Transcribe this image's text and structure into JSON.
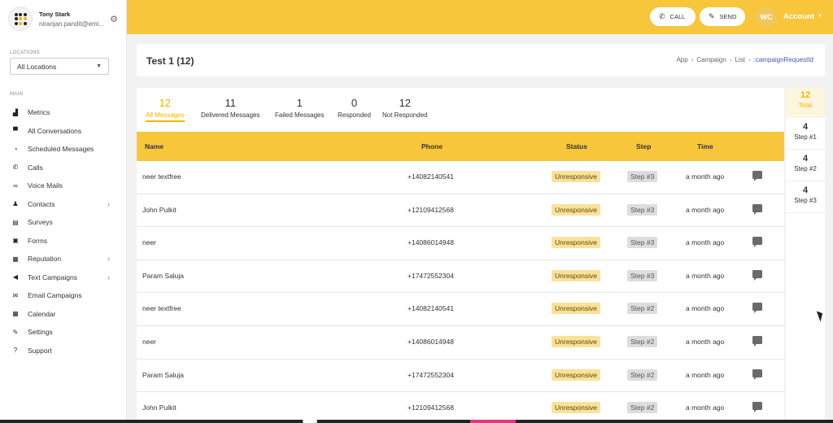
{
  "profile": {
    "name": "Tony Stark",
    "email": "niranjan.pandit@emi..."
  },
  "location": {
    "label": "LOCATIONS",
    "value": "All Locations"
  },
  "nav": {
    "section": "MAIN",
    "items": [
      {
        "label": "Metrics",
        "icon": "▟",
        "name": "metrics",
        "chevron": false
      },
      {
        "label": "All Conversations",
        "icon": "▀",
        "name": "all-conversations",
        "chevron": false
      },
      {
        "label": "Scheduled Messages",
        "icon": "◔",
        "name": "scheduled-messages",
        "chevron": false
      },
      {
        "label": "Calls",
        "icon": "✆",
        "name": "calls",
        "chevron": false
      },
      {
        "label": "Voice Mails",
        "icon": "∞",
        "name": "voice-mails",
        "chevron": false
      },
      {
        "label": "Contacts",
        "icon": "♟",
        "name": "contacts",
        "chevron": true
      },
      {
        "label": "Surveys",
        "icon": "▤",
        "name": "surveys",
        "chevron": false
      },
      {
        "label": "Forms",
        "icon": "▣",
        "name": "forms",
        "chevron": false
      },
      {
        "label": "Reputation",
        "icon": "▦",
        "name": "reputation",
        "chevron": true
      },
      {
        "label": "Text Campaigns",
        "icon": "◀",
        "name": "text-campaigns",
        "chevron": true
      },
      {
        "label": "Email Campaigns",
        "icon": "✉",
        "name": "email-campaigns",
        "chevron": false
      },
      {
        "label": "Calendar",
        "icon": "▦",
        "name": "calendar",
        "chevron": false
      },
      {
        "label": "Settings",
        "icon": "✎",
        "name": "settings",
        "chevron": false
      },
      {
        "label": "Support",
        "icon": "?",
        "name": "support",
        "chevron": false
      }
    ]
  },
  "topbar": {
    "call_label": "CALL",
    "send_label": "SEND",
    "avatar_initials": "WC",
    "account_label": "Account"
  },
  "header": {
    "title": "Test 1 (12)",
    "breadcrumb": [
      "App",
      "Campaign",
      "List",
      ":campaignRequestId"
    ]
  },
  "stats": [
    {
      "value": "12",
      "label": "All Messages",
      "active": true
    },
    {
      "value": "11",
      "label": "Delivered Messages",
      "active": false
    },
    {
      "value": "1",
      "label": "Failed Messages",
      "active": false
    },
    {
      "value": "0",
      "label": "Responded",
      "active": false
    },
    {
      "value": "12",
      "label": "Not Responded",
      "active": false
    }
  ],
  "table": {
    "columns": [
      "Name",
      "Phone",
      "Status",
      "Step",
      "Time"
    ],
    "rows": [
      {
        "name": "neer textfree",
        "phone": "+14082140541",
        "status": "Unresponsive",
        "step": "Step #3",
        "time": "a month ago"
      },
      {
        "name": "John Pulkit",
        "phone": "+12109412568",
        "status": "Unresponsive",
        "step": "Step #3",
        "time": "a month ago"
      },
      {
        "name": "neer",
        "phone": "+14086014948",
        "status": "Unresponsive",
        "step": "Step #3",
        "time": "a month ago"
      },
      {
        "name": "Param Saluja",
        "phone": "+17472552304",
        "status": "Unresponsive",
        "step": "Step #3",
        "time": "a month ago"
      },
      {
        "name": "neer textfree",
        "phone": "+14082140541",
        "status": "Unresponsive",
        "step": "Step #2",
        "time": "a month ago"
      },
      {
        "name": "neer",
        "phone": "+14086014948",
        "status": "Unresponsive",
        "step": "Step #2",
        "time": "a month ago"
      },
      {
        "name": "Param Saluja",
        "phone": "+17472552304",
        "status": "Unresponsive",
        "step": "Step #2",
        "time": "a month ago"
      },
      {
        "name": "John Pulkit",
        "phone": "+12109412568",
        "status": "Unresponsive",
        "step": "Step #2",
        "time": "a month ago"
      }
    ]
  },
  "steps": {
    "total": {
      "value": "12",
      "label": "Total"
    },
    "items": [
      {
        "value": "4",
        "label": "Step #1"
      },
      {
        "value": "4",
        "label": "Step #2"
      },
      {
        "value": "4",
        "label": "Step #3"
      }
    ]
  },
  "colors": {
    "accent": "#f8c63a",
    "active": "#f5b400",
    "link": "#3a5ba9"
  }
}
